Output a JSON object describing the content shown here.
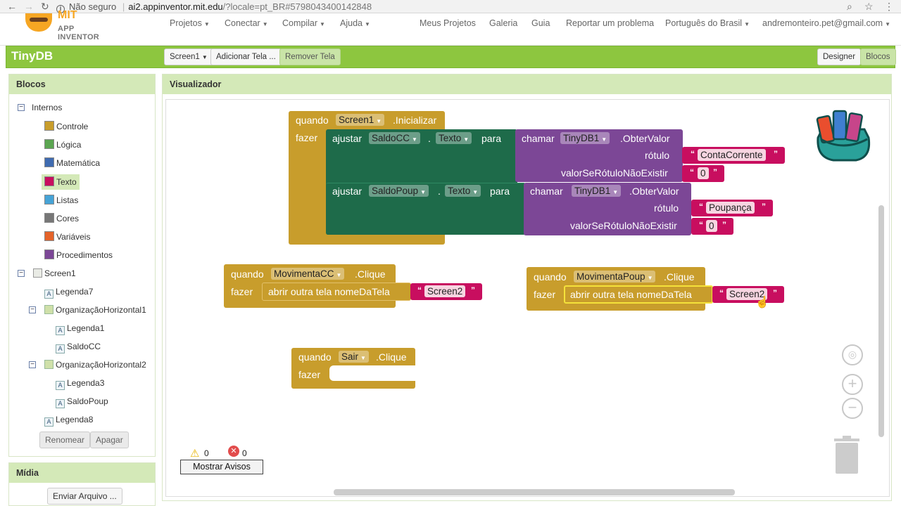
{
  "browser": {
    "security_label": "Não seguro",
    "url_host": "ai2.appinventor.mit.edu",
    "url_path": "/?locale=pt_BR#5798043400142848"
  },
  "logo": {
    "mit": "MIT",
    "app_inventor": "APP INVENTOR"
  },
  "menu": {
    "left": [
      "Projetos",
      "Conectar",
      "Compilar",
      "Ajuda"
    ],
    "right": [
      "Meus Projetos",
      "Galeria",
      "Guia",
      "Reportar um problema"
    ],
    "language": "Português do Brasil",
    "account": "andremonteiro.pet@gmail.com"
  },
  "toolbar": {
    "project_name": "TinyDB",
    "screen_select": "Screen1",
    "add_screen": "Adicionar Tela ...",
    "remove_screen": "Remover Tela",
    "designer": "Designer",
    "blocks": "Blocos"
  },
  "blocks_panel": {
    "title": "Blocos",
    "builtin": "Internos",
    "categories": [
      {
        "label": "Controle",
        "color": "#c89d2c"
      },
      {
        "label": "Lógica",
        "color": "#5ba551"
      },
      {
        "label": "Matemática",
        "color": "#3f6bb0"
      },
      {
        "label": "Texto",
        "color": "#c80e5f"
      },
      {
        "label": "Listas",
        "color": "#46a3d6"
      },
      {
        "label": "Cores",
        "color": "#777777"
      },
      {
        "label": "Variáveis",
        "color": "#e4632a"
      },
      {
        "label": "Procedimentos",
        "color": "#7c4796"
      }
    ],
    "screen": "Screen1",
    "components": [
      "Legenda7",
      "OrganizaçãoHorizontal1",
      "Legenda1",
      "SaldoCC",
      "OrganizaçãoHorizontal2",
      "Legenda3",
      "SaldoPoup",
      "Legenda8"
    ],
    "rename_button": "Renomear",
    "delete_button": "Apagar"
  },
  "media_panel": {
    "title": "Mídia",
    "upload_button": "Enviar Arquivo ..."
  },
  "viewer": {
    "title": "Visualizador",
    "warnings_count": "0",
    "errors_count": "0",
    "show_warnings": "Mostrar Avisos"
  },
  "blocks": {
    "when": "quando",
    "do": "fazer",
    "init_event": ".Inicializar",
    "click_event": ".Clique",
    "set": "ajustar",
    "dot": ".",
    "to": "para",
    "call": "chamar",
    "get_value": ".ObterValor",
    "tag": "rótulo",
    "value_if_tag_not_there": "valorSeRótuloNãoExistir",
    "open_screen": "abrir outra tela  nomeDaTela",
    "text_prop": "Texto",
    "screen1": "Screen1",
    "saldocc": "SaldoCC",
    "saldopoup": "SaldoPoup",
    "tinydb": "TinyDB1",
    "tag_cc": "ContaCorrente",
    "tag_poup": "Poupança",
    "zero": "0",
    "movimenta_cc": "MovimentaCC",
    "movimenta_poup": "MovimentaPoup",
    "screen2": "Screen2",
    "sair": "Sair"
  },
  "colors": {
    "control": "#c89d2c",
    "component_set": "#1e6b4a",
    "component_call": "#7c4796",
    "text": "#c80e5f",
    "header_green": "#8dc63f"
  }
}
